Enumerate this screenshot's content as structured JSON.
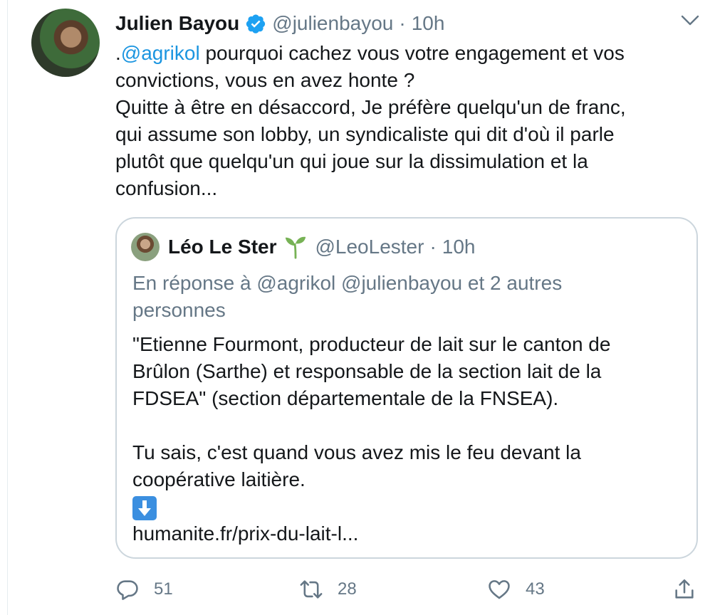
{
  "tweet": {
    "author_name": "Julien Bayou",
    "author_handle": "@julienbayou",
    "separator": "·",
    "time": "10h",
    "text_lines": [
      [
        ".",
        "@agrikol",
        " pourquoi cachez vous votre engagement et vos"
      ],
      "convictions, vous en avez honte ?",
      "Quitte à être en désaccord, Je préfère quelqu'un de franc,",
      "qui assume son lobby, un syndicaliste qui dit d'où il parle",
      "plutôt que quelqu'un qui joue sur la dissimulation et la",
      "confusion..."
    ]
  },
  "tweet_line0": {
    "prefix": ".",
    "mention": "@agrikol",
    "rest": " pourquoi cachez vous votre engagement et vos"
  },
  "tweet_lines": {
    "l1": "convictions, vous en avez honte ?",
    "l2": "Quitte à être en désaccord, Je préfère quelqu'un de franc,",
    "l3": "qui assume son lobby, un syndicaliste qui dit d'où il parle",
    "l4": "plutôt que quelqu'un qui joue sur la dissimulation et la",
    "l5": "confusion..."
  },
  "quote": {
    "author_name": "Léo Le Ster",
    "author_handle": "@LeoLester",
    "separator": "·",
    "time": "10h",
    "reply_line1": "En réponse à @agrikol @julienbayou  et 2 autres",
    "reply_line2": "personnes",
    "l1": "\"Etienne Fourmont, producteur de lait sur le canton de",
    "l2": "Brûlon (Sarthe) et responsable de la section lait de la",
    "l3": "FDSEA\" (section départementale de la FNSEA).",
    "l5": "Tu sais, c'est quand vous avez mis le feu devant la",
    "l6": "coopérative laitière.",
    "link": "humanite.fr/prix-du-lait-l..."
  },
  "actions": {
    "replies": "51",
    "retweets": "28",
    "likes": "43"
  },
  "icons": {
    "verified": "verified-badge-icon",
    "sprout": "seedling-icon",
    "arrow": "down-arrow-emoji-icon",
    "reply": "reply-icon",
    "retweet": "retweet-icon",
    "like": "heart-icon",
    "share": "share-icon",
    "caret": "chevron-down-icon"
  },
  "colors": {
    "link_blue": "#1b95e0",
    "muted_gray": "#657786",
    "border": "#ccd6dd",
    "verified_blue": "#1da1f2",
    "sprout_green": "#77b255"
  }
}
